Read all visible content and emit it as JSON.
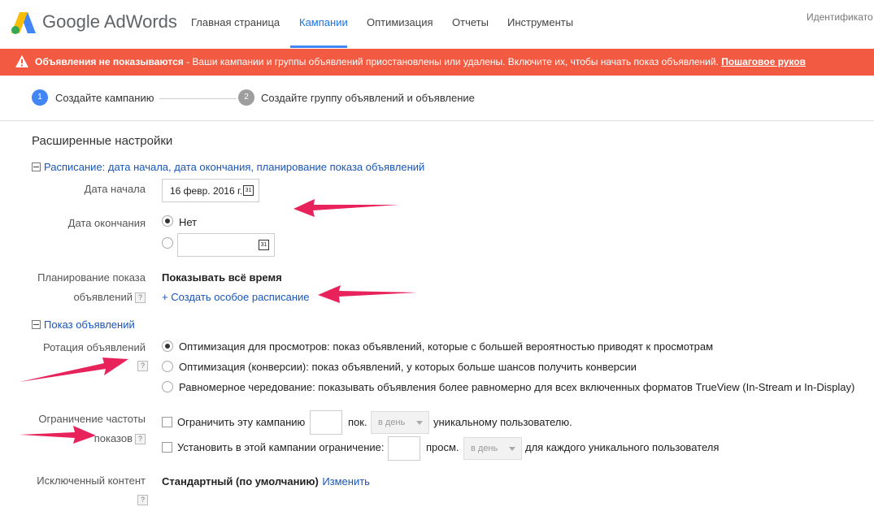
{
  "brand": {
    "logo_text": "Google AdWords",
    "accent": "#4285f4",
    "alert_color": "#f25a41",
    "arrow_color": "#e8225b"
  },
  "nav": {
    "items": [
      "Главная страница",
      "Кампании",
      "Оптимизация",
      "Отчеты",
      "Инструменты"
    ],
    "active": "Кампании",
    "account_label": "Идентификато"
  },
  "alert": {
    "icon": "warning-icon",
    "title": "Объявления не показываются",
    "message": " - Ваши кампании и группы объявлений приостановлены или удалены. Включите их, чтобы начать показ объявлений. ",
    "link": "Пошаговое руков"
  },
  "stepper": {
    "steps": [
      {
        "number": "1",
        "label": "Создайте кампанию",
        "active": true
      },
      {
        "number": "2",
        "label": "Создайте группу объявлений и объявление",
        "active": false
      }
    ]
  },
  "advanced": {
    "title": "Расширенные настройки",
    "schedule_header": "Расписание: дата начала, дата окончания, планирование показа объявлений",
    "start_date_label": "Дата начала",
    "start_date_value": "16 февр. 2016 г.",
    "calendar_icon_text": "31",
    "end_date_label": "Дата окончания",
    "end_date_none": "Нет",
    "end_date_value": "",
    "ad_schedule_label_1": "Планирование показа",
    "ad_schedule_label_2": "объявлений",
    "ad_schedule_value": "Показывать всё время",
    "ad_schedule_link": "+ Создать особое расписание",
    "delivery_header": "Показ объявлений",
    "rotation_label": "Ротация объявлений",
    "rotation_options": [
      "Оптимизация для просмотров: показ объявлений, которые с большей вероятностью приводят к просмотрам",
      "Оптимизация (конверсии): показ объявлений, у которых больше шансов получить конверсии",
      "Равномерное чередование: показывать объявления более равномерно для всех включенных форматов TrueView (In-Stream и In-Display)"
    ],
    "rotation_selected": 0,
    "frequency_label_1": "Ограничение частоты",
    "frequency_label_2": "показов",
    "frequency_rows": [
      {
        "prefix": "Ограничить эту кампанию",
        "value": "",
        "unit": "пок.",
        "period": "в день",
        "suffix": "уникальному пользователю."
      },
      {
        "prefix": "Установить в этой кампании ограничение:",
        "value": "",
        "unit": "просм.",
        "period": "в день",
        "suffix": "для каждого уникального пользователя"
      }
    ],
    "excluded_label": "Исключенный контент",
    "excluded_value": "Стандартный (по умолчанию)",
    "excluded_link": "Изменить",
    "help_text": "?"
  }
}
